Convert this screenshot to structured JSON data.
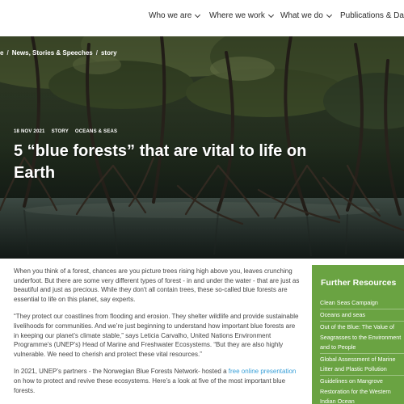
{
  "nav": {
    "items": [
      {
        "label": "Who we are",
        "has_dropdown": true
      },
      {
        "label": "Where we work",
        "has_dropdown": true
      },
      {
        "label": "What we do",
        "has_dropdown": true
      },
      {
        "label": "Publications & Data",
        "has_dropdown": false
      }
    ]
  },
  "breadcrumb": {
    "items": [
      "e",
      "News, Stories & Speeches",
      "story"
    ],
    "separator": "/"
  },
  "hero": {
    "date": "18 NOV 2021",
    "type": "STORY",
    "topic": "OCEANS & SEAS",
    "title": "5 “blue forests” that are vital to life on Earth"
  },
  "article": {
    "p1": "When you think of a forest, chances are you picture trees rising high above you, leaves crunching underfoot. But there are some very different types of forest - in and under the water -  that are just as beautiful and just as precious. While they don't all contain trees, these so-called blue forests are essential to life on this planet, say experts.",
    "p2": "“They protect our coastlines from flooding and erosion. They shelter wildlife and provide sustainable livelihoods for communities. And we’re just beginning to understand how important blue forests are in keeping our planet’s climate stable,” says Leticia Carvalho, United Nations Environment Programme’s (UNEP’s) Head of Marine and Freshwater Ecosystems. “But they are also highly vulnerable. We need to cherish and protect these vital resources.”",
    "p3_before": "In 2021, UNEP’s partners - the Norwegian Blue Forests Network- hosted a ",
    "p3_link": "free online presentation",
    "p3_after": " on how to protect and revive these ecosystems. Here’s a look at five of the most important blue forests."
  },
  "sidebar": {
    "title": "Further Resources",
    "items": [
      "Clean Seas Campaign",
      "Oceans and seas",
      "Out of the Blue: The Value of Seagrasses to the Environment and to People",
      "Global Assessment of Marine Litter and Plastic Pollution",
      "Guidelines on Mangrove Restoration for the Western Indian Ocean"
    ]
  },
  "colors": {
    "sidebar_bg": "#6aa342",
    "link": "#3aa0d8",
    "hero_text": "#ffffff"
  },
  "icons": {
    "dropdown": "chevron-down-icon"
  }
}
